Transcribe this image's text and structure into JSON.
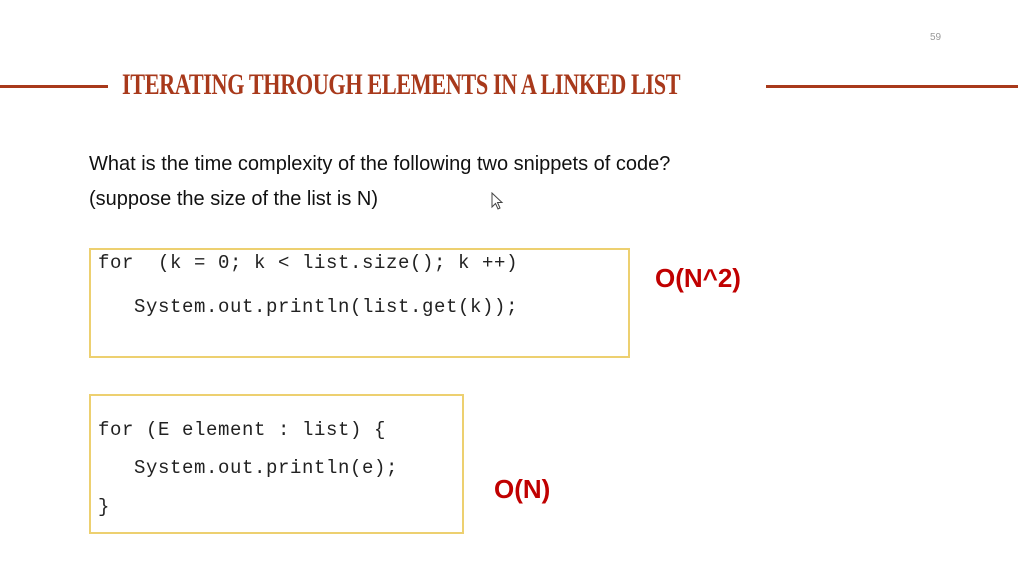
{
  "slide": {
    "page_number": "59",
    "title": "ITERATING THROUGH ELEMENTS IN A LINKED LIST",
    "accent_color": "#A8391B",
    "question_line1": "What is the time complexity of the following two snippets of code?",
    "question_line2": "(suppose the size of the list is N)",
    "snippet1": {
      "lines": [
        "for  (k = 0; k < list.size(); k ++)",
        "   System.out.println(list.get(k));"
      ],
      "answer": "O(N^2)"
    },
    "snippet2": {
      "lines": [
        "for (E element : list) {",
        "   System.out.println(e);",
        "}"
      ],
      "answer": "O(N)"
    },
    "answer_color": "#C00000",
    "box_border_color": "#EDD070",
    "cursor_icon": "arrow-pointer"
  }
}
